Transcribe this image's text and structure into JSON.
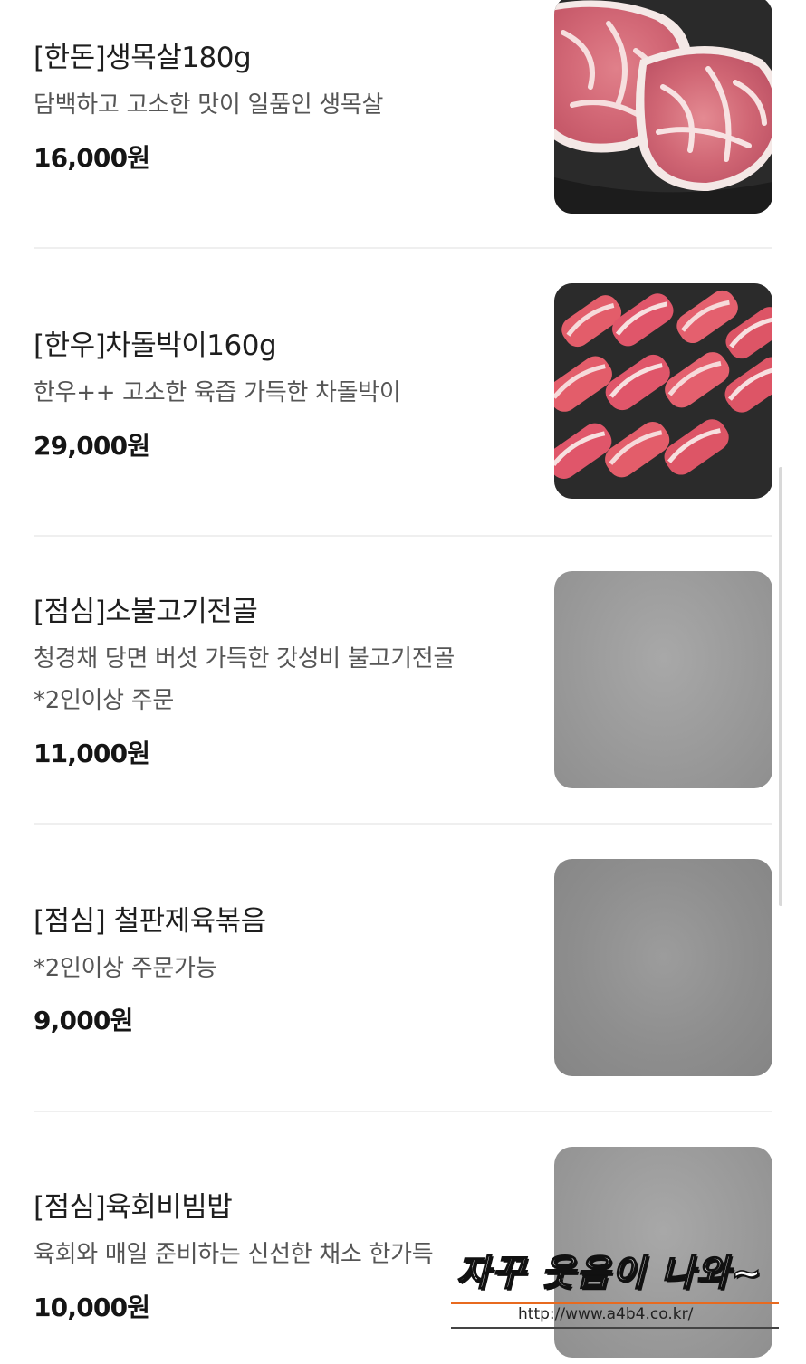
{
  "menu": {
    "items": [
      {
        "name": "[한돈]생목살180g",
        "description": [
          "담백하고 고소한 맛이 일품인 생목살"
        ],
        "price": "16,000원",
        "image": "pork-neck-photo"
      },
      {
        "name": "[한우]차돌박이160g",
        "description": [
          "한우++ 고소한 육즙 가득한 차돌박이"
        ],
        "price": "29,000원",
        "image": "beef-brisket-photo"
      },
      {
        "name": "[점심]소불고기전골",
        "description": [
          "청경채 당면 버섯 가득한 갓성비 불고기전골",
          "*2인이상 주문"
        ],
        "price": "11,000원",
        "image": "placeholder-gray"
      },
      {
        "name": "[점심] 철판제육볶음",
        "description": [
          "*2인이상 주문가능"
        ],
        "price": "9,000원",
        "image": "placeholder-gray"
      },
      {
        "name": "[점심]육회비빔밥",
        "description": [
          "육회와 매일 준비하는 신선한 채소 한가득"
        ],
        "price": "10,000원",
        "image": "placeholder-gray"
      }
    ]
  },
  "watermark": {
    "text": "자꾸 웃음이 나와~",
    "url": "http://www.a4b4.co.kr/"
  },
  "colors": {
    "text_primary": "#1e1e1e",
    "text_secondary": "#555555",
    "divider": "#efefef",
    "watermark_accent": "#e86a1f"
  }
}
